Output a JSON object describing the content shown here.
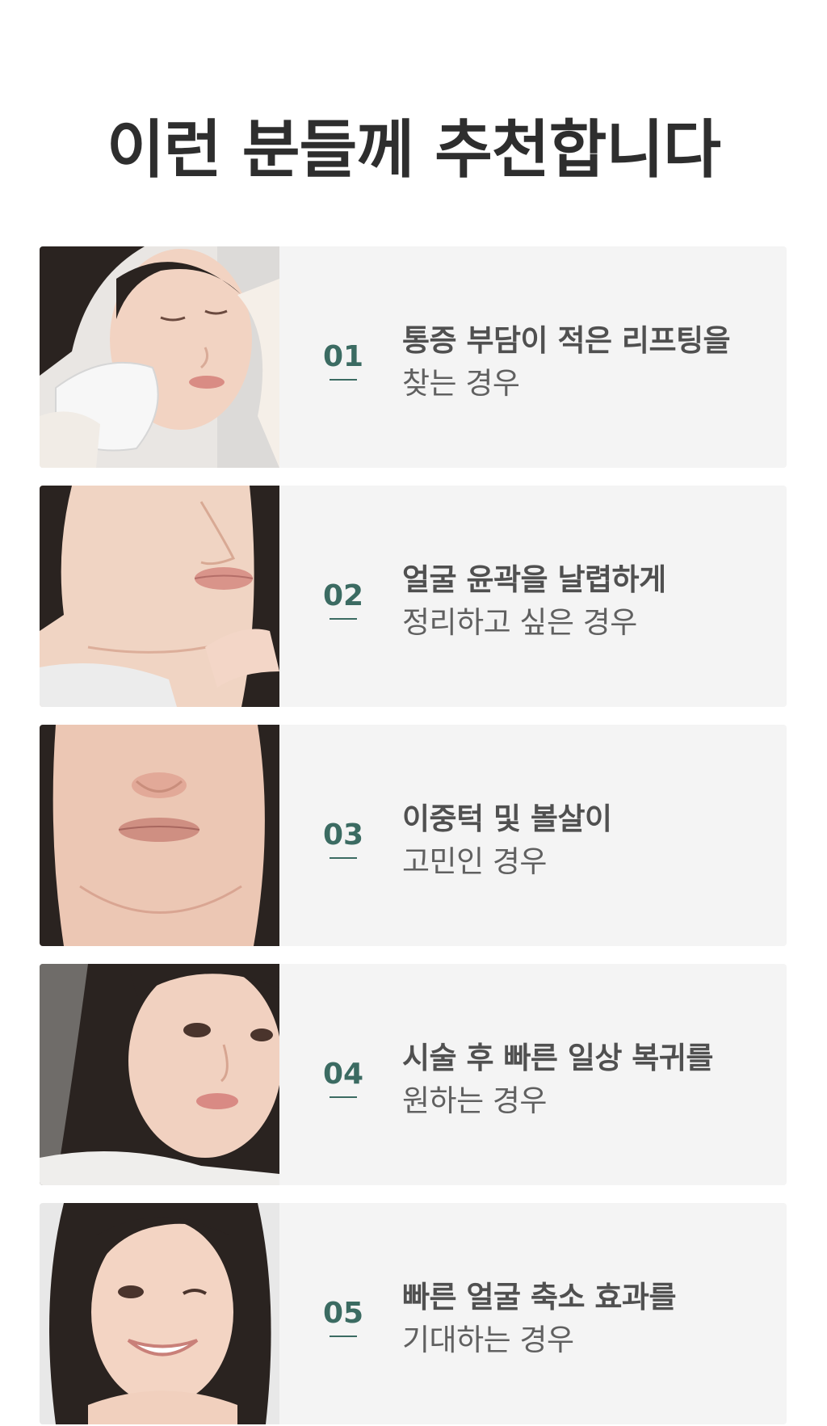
{
  "section": {
    "title": "이런 분들께 추천합니다"
  },
  "items": [
    {
      "number": "01",
      "line1": "통증 부담이 적은 리프팅을",
      "line2": "찾는 경우"
    },
    {
      "number": "02",
      "line1": "얼굴 윤곽을 날렵하게",
      "line2": "정리하고 싶은 경우"
    },
    {
      "number": "03",
      "line1": "이중턱 및 볼살이",
      "line2": "고민인 경우"
    },
    {
      "number": "04",
      "line1": "시술 후 빠른 일상 복귀를",
      "line2": "원하는 경우"
    },
    {
      "number": "05",
      "line1": "빠른 얼굴 축소 효과를",
      "line2": "기대하는 경우"
    }
  ],
  "colors": {
    "accent": "#3b6b62",
    "card_bg": "#f4f4f4",
    "title": "#2e2e2e",
    "body_text": "#555555"
  }
}
